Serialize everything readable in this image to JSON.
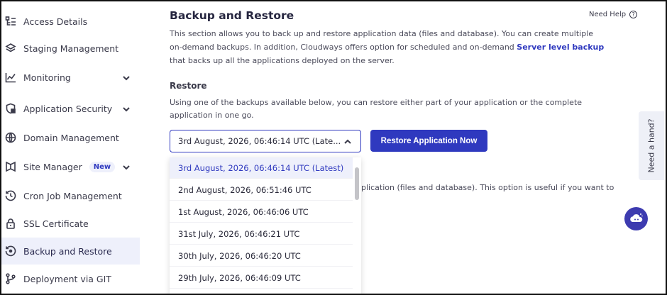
{
  "sidebar": {
    "items": [
      {
        "label": "Access Details",
        "icon": "access-details-icon"
      },
      {
        "label": "Staging Management",
        "icon": "layers-icon"
      },
      {
        "label": "Monitoring",
        "icon": "chart-line-icon",
        "expandable": true
      },
      {
        "label": "Application Security",
        "icon": "shield-icon",
        "expandable": true
      },
      {
        "label": "Domain Management",
        "icon": "www-globe-icon"
      },
      {
        "label": "Site Manager",
        "icon": "site-manager-icon",
        "expandable": true,
        "badge": "New"
      },
      {
        "label": "Cron Job Management",
        "icon": "clock-history-icon"
      },
      {
        "label": "SSL Certificate",
        "icon": "lock-icon"
      },
      {
        "label": "Backup and Restore",
        "icon": "backup-restore-icon",
        "active": true
      },
      {
        "label": "Deployment via GIT",
        "icon": "git-branch-icon"
      }
    ]
  },
  "header": {
    "title": "Backup and Restore",
    "need_help": "Need Help"
  },
  "intro": {
    "text_before": "This section allows you to back up and restore application data (files and database). You can create multiple on-demand backups. In addition, Cloudways offers option for scheduled and on-demand ",
    "link": "Server level backup",
    "text_after": " that backs up all the applications deployed on the server."
  },
  "restore": {
    "heading": "Restore",
    "description": "Using one of the backups available below, you can restore either part of your application or the complete application in one go.",
    "selected_value": "3rd August, 2026, 06:46:14 UTC (Late...",
    "button": "Restore Application Now",
    "options": [
      "3rd August, 2026, 06:46:14 UTC (Latest)",
      "2nd August, 2026, 06:51:46 UTC",
      "1st August, 2026, 06:46:06 UTC",
      "31st July, 2026, 06:46:21 UTC",
      "30th July, 2026, 06:46:20 UTC",
      "29th July, 2026, 06:46:09 UTC"
    ],
    "partial_text": "plication (files and database). This option is useful if you want to"
  },
  "help_tab": "Need a hand?",
  "colors": {
    "accent": "#2f39bf",
    "active_bg": "#eef0fb"
  }
}
